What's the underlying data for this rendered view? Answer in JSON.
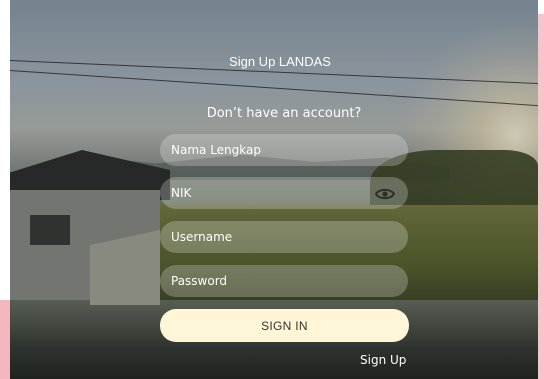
{
  "header": {
    "title": "Sign Up LANDAS",
    "subtitle": "Don’t have an account?"
  },
  "form": {
    "full_name": {
      "placeholder": "Nama Lengkap",
      "value": ""
    },
    "nik": {
      "placeholder": "NIK",
      "value": ""
    },
    "username": {
      "placeholder": "Username",
      "value": ""
    },
    "password": {
      "placeholder": "Password",
      "value": ""
    },
    "submit_label": "SIGN IN",
    "nik_toggle_icon": "eye-icon"
  },
  "footer": {
    "signup_link": "Sign Up"
  },
  "colors": {
    "button_bg": "#fff6d7",
    "field_bg": "rgba(255,255,255,0.24)",
    "text": "#ffffff"
  }
}
